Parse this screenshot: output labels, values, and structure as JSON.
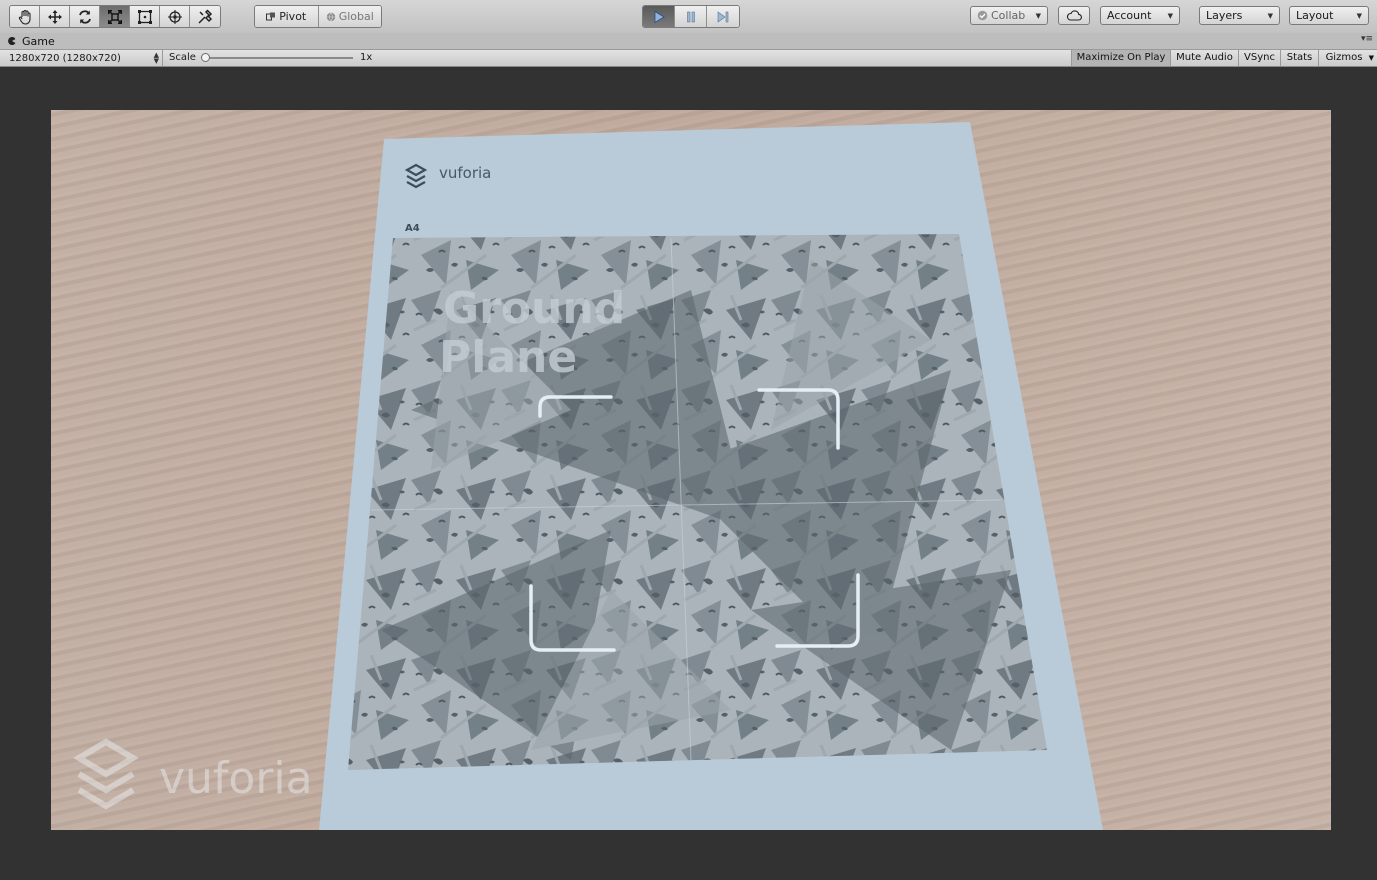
{
  "toolbar": {
    "transform_tools": [
      "hand-tool",
      "move-tool",
      "rotate-tool",
      "scale-tool",
      "rect-tool",
      "transform-tool",
      "custom-tool"
    ],
    "active_tool": "scale-tool",
    "pivot_label": "Pivot",
    "global_label": "Global",
    "play_controls": [
      "play",
      "pause",
      "step"
    ],
    "collab_label": "Collab",
    "account_label": "Account",
    "layers_label": "Layers",
    "layout_label": "Layout"
  },
  "game_tab": {
    "title": "Game"
  },
  "game_toolbar": {
    "resolution": "1280x720 (1280x720)",
    "scale_label": "Scale",
    "scale_value": "1x",
    "scale_level": 0,
    "maximize_on_play": "Maximize On Play",
    "mute_audio": "Mute Audio",
    "vsync": "VSync",
    "stats": "Stats",
    "gizmos": "Gizmos"
  },
  "game_view": {
    "paper_logo_text": "vuforia",
    "paper_size_label": "A4",
    "target_title_line1": "Ground",
    "target_title_line2": "Plane",
    "watermark_text": "vuforia",
    "colors": {
      "table": "#c2ada0",
      "paper": "#b9cad8",
      "target_pattern": "#8f9ba3",
      "reticle": "#e6eef5"
    }
  }
}
